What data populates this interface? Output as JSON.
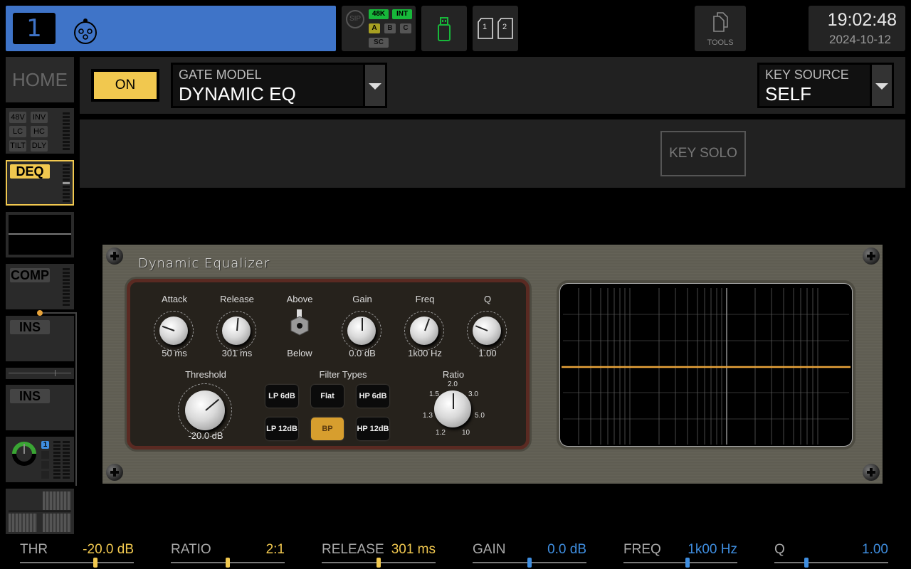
{
  "topbar": {
    "channel_number": "1",
    "channel_color": "#3f74c8",
    "input_icon": "xlr-connector-icon",
    "sip_label": "SIP",
    "sample_rate": "48K",
    "clock_source": "INT",
    "buses": [
      "A",
      "B",
      "C"
    ],
    "sc_label": "SC",
    "usb_icon": "usb-drive-icon",
    "sd_cards": [
      "1",
      "2"
    ],
    "tools_label": "TOOLS",
    "time": "19:02:48",
    "date": "2024-10-12"
  },
  "sidebar": {
    "home_label": "HOME",
    "input_tags": [
      "48V",
      "INV",
      "LC",
      "HC",
      "TILT",
      "DLY"
    ],
    "fx_slots": [
      {
        "label": "DEQ",
        "active": true
      },
      {
        "label": "COMP",
        "active": false
      },
      {
        "label": "INS",
        "active": false
      },
      {
        "label": "INS",
        "active": false
      }
    ],
    "bus_badge": "1"
  },
  "header": {
    "on_label": "ON",
    "gate_model_label": "GATE MODEL",
    "gate_model_value": "DYNAMIC EQ",
    "key_source_label": "KEY SOURCE",
    "key_source_value": "SELF",
    "key_solo_label": "KEY SOLO"
  },
  "plugin": {
    "title": "Dynamic Equalizer",
    "knobs": [
      {
        "label": "Attack",
        "value": "50 ms"
      },
      {
        "label": "Release",
        "value": "301 ms"
      },
      {
        "label": "Gain",
        "value": "0.0 dB"
      },
      {
        "label": "Freq",
        "value": "1k00 Hz"
      },
      {
        "label": "Q",
        "value": "1.00"
      }
    ],
    "switch": {
      "top_label": "Above",
      "bottom_label": "Below"
    },
    "threshold": {
      "label": "Threshold",
      "value": "-20.0 dB"
    },
    "filter_types_label": "Filter Types",
    "filter_types": [
      "LP 6dB",
      "Flat",
      "HP 6dB",
      "LP 12dB",
      "BP",
      "HP 12dB"
    ],
    "filter_active": "BP",
    "ratio": {
      "label": "Ratio",
      "scale": [
        "1.2",
        "1.3",
        "1.5",
        "2.0",
        "3.0",
        "5.0",
        "10"
      ]
    },
    "curve_color": "#e8a33a"
  },
  "params": [
    {
      "name": "THR",
      "value": "-20.0 dB",
      "color": "#f1c84f",
      "position": 0.66
    },
    {
      "name": "RATIO",
      "value": "2:1",
      "color": "#f1c84f",
      "position": 0.5
    },
    {
      "name": "RELEASE",
      "value": "301 ms",
      "color": "#f1c84f",
      "position": 0.5
    },
    {
      "name": "GAIN",
      "value": "0.0 dB",
      "color": "#3f8ee0",
      "position": 0.5
    },
    {
      "name": "FREQ",
      "value": "1k00 Hz",
      "color": "#3f8ee0",
      "position": 0.56
    },
    {
      "name": "Q",
      "value": "1.00",
      "color": "#3f8ee0",
      "position": 0.28
    }
  ]
}
